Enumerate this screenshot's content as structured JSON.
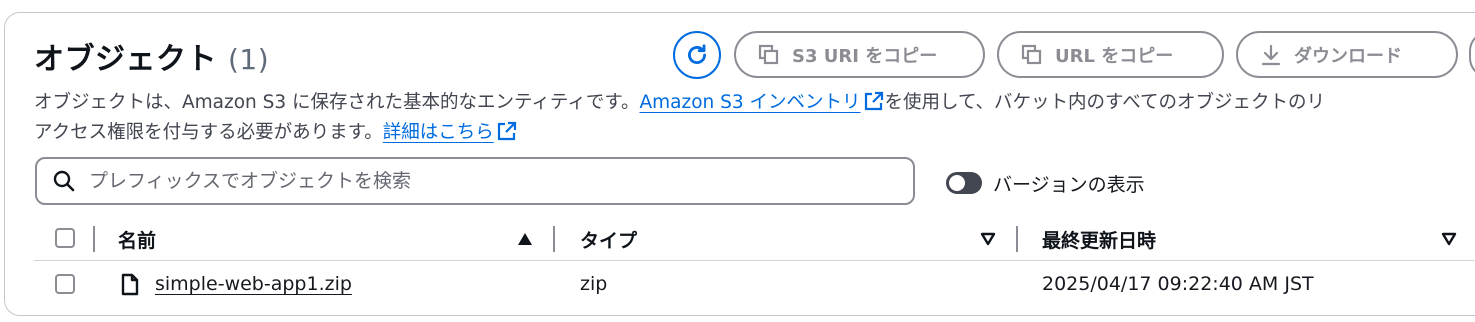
{
  "header": {
    "title": "オブジェクト",
    "count": "(1)"
  },
  "actions": {
    "refresh_icon": "refresh-icon",
    "copy_s3_uri": "S3 URI をコピー",
    "copy_url": "URL をコピー",
    "download": "ダウンロード"
  },
  "description": {
    "line1_prefix": "オブジェクトは、Amazon S3 に保存された基本的なエンティティです。",
    "inventory_link": "Amazon S3 インベントリ",
    "line1_suffix": "を使用して、バケット内のすべてのオブジェクトのリ",
    "line2_prefix": "アクセス権限を付与する必要があります。",
    "details_link": "詳細はこちら"
  },
  "search": {
    "placeholder": "プレフィックスでオブジェクトを検索",
    "value": ""
  },
  "version_toggle": {
    "label": "バージョンの表示",
    "on": false
  },
  "table": {
    "columns": [
      "名前",
      "タイプ",
      "最終更新日時"
    ],
    "sort": {
      "column": "名前",
      "direction": "ascending"
    },
    "rows": [
      {
        "name": "simple-web-app1.zip",
        "type": "zip",
        "last_modified": "2025/04/17 09:22:40 AM JST"
      }
    ]
  },
  "colors": {
    "link": "#006ce0",
    "primary_text": "#0f141a",
    "disabled": "#8c8c94"
  }
}
